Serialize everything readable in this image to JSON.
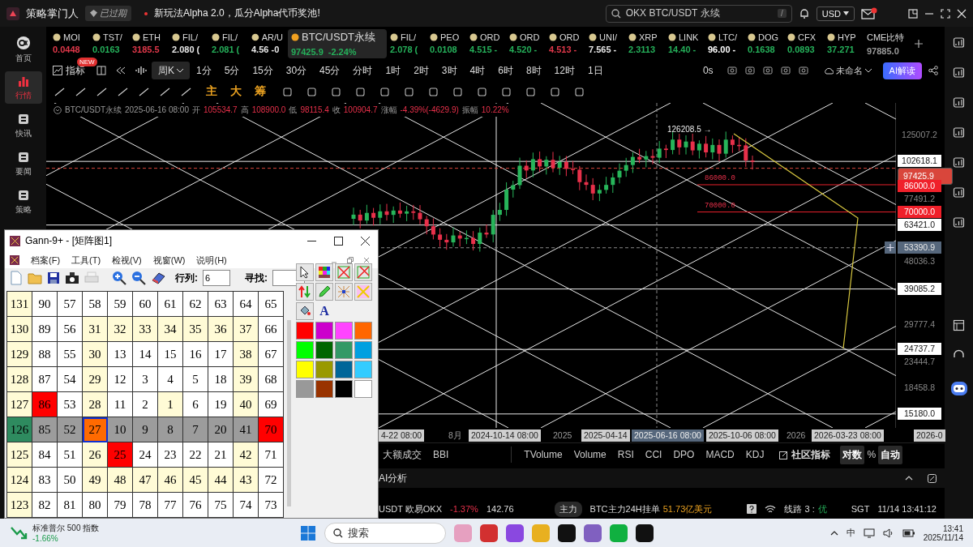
{
  "top_bar": {
    "app_name": "策略掌门人",
    "badge": "已过期",
    "announcement": "新玩法Alpha 2.0，瓜分Alpha代币奖池!",
    "search": "OKX BTC/USDT 永续",
    "search_key": "/",
    "currency": "USD"
  },
  "sidebar": {
    "items": [
      {
        "label": "首页",
        "selected": false
      },
      {
        "label": "行情",
        "selected": true
      },
      {
        "label": "快讯",
        "selected": false
      },
      {
        "label": "要闻",
        "selected": false
      },
      {
        "label": "策略",
        "selected": false
      }
    ]
  },
  "tickers": [
    {
      "name": "MOI",
      "price": "0.0448",
      "color": "#e0384a",
      "selected": false
    },
    {
      "name": "TST/",
      "price": "0.0163",
      "color": "#25b05a",
      "selected": false
    },
    {
      "name": "ETH",
      "price": "3185.5",
      "color": "#e0384a",
      "selected": false
    },
    {
      "name": "FIL/",
      "price": "2.080 (",
      "color": "#e8e8e8",
      "selected": false
    },
    {
      "name": "FIL/",
      "price": "2.081 (",
      "color": "#25b05a",
      "selected": false
    },
    {
      "name": "AR/U",
      "price": "4.56 -0",
      "color": "#e8e8e8",
      "selected": false
    },
    {
      "name": "BTC/USDT永续",
      "price": "97425.9",
      "change": "-2.24%",
      "color": "#25b05a",
      "selected": true
    },
    {
      "name": "FIL/",
      "price": "2.078 (",
      "color": "#25b05a",
      "selected": false
    },
    {
      "name": "PEO",
      "price": "0.0108",
      "color": "#25b05a",
      "selected": false
    },
    {
      "name": "ORD",
      "price": "4.515 -",
      "color": "#25b05a",
      "selected": false
    },
    {
      "name": "ORD",
      "price": "4.520 -",
      "color": "#25b05a",
      "selected": false
    },
    {
      "name": "ORD",
      "price": "4.513 -",
      "color": "#e0384a",
      "selected": false
    },
    {
      "name": "UNI/",
      "price": "7.565 -",
      "color": "#e8e8e8",
      "selected": false
    },
    {
      "name": "XRP",
      "price": "2.3113",
      "color": "#25b05a",
      "selected": false
    },
    {
      "name": "LINK",
      "price": "14.40 -",
      "color": "#25b05a",
      "selected": false
    },
    {
      "name": "LTC/",
      "price": "96.00 -",
      "color": "#ffffff",
      "selected": false
    },
    {
      "name": "DOG",
      "price": "0.1638",
      "color": "#25b05a",
      "selected": false
    },
    {
      "name": "CFX",
      "price": "0.0893",
      "color": "#25b05a",
      "selected": false
    },
    {
      "name": "HYP",
      "price": "37.271",
      "color": "#25b05a",
      "selected": false
    },
    {
      "name": "CME比特",
      "price": "97885.0",
      "color": "#9a9a9a",
      "selected": false
    }
  ],
  "toolbar": {
    "indicator_label": "指标",
    "new_badge": "NEW",
    "period": "周K",
    "timeframes": [
      "1分",
      "5分",
      "15分",
      "30分",
      "45分",
      "分时",
      "1时",
      "2时",
      "3时",
      "4时",
      "6时",
      "8时",
      "12时",
      "1日"
    ],
    "refresh": "0s",
    "layout_name": "未命名",
    "ai_button": "AI解读"
  },
  "drawing_tools": {
    "markers": [
      "主",
      "大",
      "筹"
    ]
  },
  "chart": {
    "info": {
      "symbol": "BTC/USDT永续",
      "date": "2025-06-16 08:00",
      "fields": [
        {
          "label": "开",
          "value": "105534.7"
        },
        {
          "label": "高",
          "value": "108900.0"
        },
        {
          "label": "低",
          "value": "98115.4"
        },
        {
          "label": "收",
          "value": "100904.7"
        },
        {
          "label": "涨幅",
          "value": "-4.39%(-4629.9)"
        },
        {
          "label": "振幅",
          "value": "10.22%"
        }
      ]
    },
    "high_label": "126208.5 →",
    "levels": [
      {
        "text": "86000.0"
      },
      {
        "text": "70000.0"
      }
    ],
    "price_labels": [
      {
        "text": "125007.2",
        "kind": "tick"
      },
      {
        "text": "102618.1",
        "kind": "line"
      },
      {
        "text": "97425.9",
        "kind": "current"
      },
      {
        "text": "86000.0",
        "kind": "alert"
      },
      {
        "text": "77491.2",
        "kind": "tick"
      },
      {
        "text": "70000.0",
        "kind": "alert"
      },
      {
        "text": "63421.0",
        "kind": "line"
      },
      {
        "text": "53390.9",
        "kind": "cursor"
      },
      {
        "text": "48036.3",
        "kind": "tick"
      },
      {
        "text": "39085.2",
        "kind": "line"
      },
      {
        "text": "29777.4",
        "kind": "tick"
      },
      {
        "text": "24737.7",
        "kind": "line"
      },
      {
        "text": "23444.7",
        "kind": "tick"
      },
      {
        "text": "18458.8",
        "kind": "tick"
      },
      {
        "text": "15180.0",
        "kind": "line"
      }
    ],
    "time_labels": [
      {
        "text": "4-22 08:00",
        "kind": "box"
      },
      {
        "text": "8月",
        "kind": "plain"
      },
      {
        "text": "2024-10-14 08:00",
        "kind": "box"
      },
      {
        "text": "2025",
        "kind": "plain"
      },
      {
        "text": "2025-04-14",
        "kind": "box"
      },
      {
        "text": "2025-06-16 08:00",
        "kind": "cursor"
      },
      {
        "text": "2025-10-06 08:00",
        "kind": "box"
      },
      {
        "text": "2026",
        "kind": "plain"
      },
      {
        "text": "2026-03-23 08:00",
        "kind": "box"
      },
      {
        "text": "2026-0",
        "kind": "box"
      }
    ]
  },
  "indicator_tabs": {
    "left": [
      "大额成交",
      "BBI"
    ],
    "right": [
      "TVolume",
      "Volume",
      "RSI",
      "CCI",
      "DPO",
      "MACD",
      "KDJ"
    ],
    "community": "社区指标",
    "scale": [
      {
        "label": "对数",
        "selected": true
      },
      {
        "label": "%",
        "selected": false
      },
      {
        "label": "自动",
        "selected": true
      }
    ]
  },
  "ai_panel": {
    "title": "AI分析"
  },
  "status_bar": {
    "pair": "USDT 欧易OKX",
    "change": "-1.37%",
    "value": "142.76",
    "tag": "主力",
    "order_label": "BTC主力24H挂单",
    "order_value": "51.73亿美元",
    "route_label": "线路 3 :",
    "route_quality": "优",
    "timezone": "SGT",
    "datetime": "11/14 13:41:12"
  },
  "gann_window": {
    "title": "Gann-9+ - [矩阵图1]",
    "menu": [
      "档案(F)",
      "工具(T)",
      "检视(V)",
      "视窗(W)",
      "说明(H)"
    ],
    "rows_label": "行列:",
    "rows_value": "6",
    "find_label": "寻找:",
    "text_tool": "A",
    "grid": [
      [
        {
          "text": "131",
          "color": "#fffbd6",
          "selected": false
        },
        {
          "text": "90",
          "color": "#ffffff",
          "selected": false
        },
        {
          "text": "57",
          "color": "#ffffff",
          "selected": false
        },
        {
          "text": "58",
          "color": "#ffffff",
          "selected": false
        },
        {
          "text": "59",
          "color": "#ffffff",
          "selected": false
        },
        {
          "text": "60",
          "color": "#ffffff",
          "selected": false
        },
        {
          "text": "61",
          "color": "#ffffff",
          "selected": false
        },
        {
          "text": "62",
          "color": "#ffffff",
          "selected": false
        },
        {
          "text": "63",
          "color": "#ffffff",
          "selected": false
        },
        {
          "text": "64",
          "color": "#ffffff",
          "selected": false
        },
        {
          "text": "65",
          "color": "#ffffff",
          "selected": false
        }
      ],
      [
        {
          "text": "130",
          "color": "#fffbd6",
          "selected": false
        },
        {
          "text": "89",
          "color": "#ffffff",
          "selected": false
        },
        {
          "text": "56",
          "color": "#ffffff",
          "selected": false
        },
        {
          "text": "31",
          "color": "#fffbd6",
          "selected": false
        },
        {
          "text": "32",
          "color": "#fffbd6",
          "selected": false
        },
        {
          "text": "33",
          "color": "#fffbd6",
          "selected": false
        },
        {
          "text": "34",
          "color": "#fffbd6",
          "selected": false
        },
        {
          "text": "35",
          "color": "#fffbd6",
          "selected": false
        },
        {
          "text": "36",
          "color": "#fffbd6",
          "selected": false
        },
        {
          "text": "37",
          "color": "#fffbd6",
          "selected": false
        },
        {
          "text": "66",
          "color": "#ffffff",
          "selected": false
        }
      ],
      [
        {
          "text": "129",
          "color": "#fffbd6",
          "selected": false
        },
        {
          "text": "88",
          "color": "#ffffff",
          "selected": false
        },
        {
          "text": "55",
          "color": "#ffffff",
          "selected": false
        },
        {
          "text": "30",
          "color": "#fffbd6",
          "selected": false
        },
        {
          "text": "13",
          "color": "#ffffff",
          "selected": false
        },
        {
          "text": "14",
          "color": "#ffffff",
          "selected": false
        },
        {
          "text": "15",
          "color": "#ffffff",
          "selected": false
        },
        {
          "text": "16",
          "color": "#ffffff",
          "selected": false
        },
        {
          "text": "17",
          "color": "#ffffff",
          "selected": false
        },
        {
          "text": "38",
          "color": "#fffbd6",
          "selected": false
        },
        {
          "text": "67",
          "color": "#ffffff",
          "selected": false
        }
      ],
      [
        {
          "text": "128",
          "color": "#fffbd6",
          "selected": false
        },
        {
          "text": "87",
          "color": "#ffffff",
          "selected": false
        },
        {
          "text": "54",
          "color": "#ffffff",
          "selected": false
        },
        {
          "text": "29",
          "color": "#fffbd6",
          "selected": false
        },
        {
          "text": "12",
          "color": "#ffffff",
          "selected": false
        },
        {
          "text": "3",
          "color": "#ffffff",
          "selected": false
        },
        {
          "text": "4",
          "color": "#ffffff",
          "selected": false
        },
        {
          "text": "5",
          "color": "#ffffff",
          "selected": false
        },
        {
          "text": "18",
          "color": "#ffffff",
          "selected": false
        },
        {
          "text": "39",
          "color": "#fffbd6",
          "selected": false
        },
        {
          "text": "68",
          "color": "#ffffff",
          "selected": false
        }
      ],
      [
        {
          "text": "127",
          "color": "#fffbd6",
          "selected": false
        },
        {
          "text": "86",
          "color": "#ff0000",
          "selected": false
        },
        {
          "text": "53",
          "color": "#ffffff",
          "selected": false
        },
        {
          "text": "28",
          "color": "#fffbd6",
          "selected": false
        },
        {
          "text": "11",
          "color": "#ffffff",
          "selected": false
        },
        {
          "text": "2",
          "color": "#ffffff",
          "selected": false
        },
        {
          "text": "1",
          "color": "#fffbd6",
          "selected": false
        },
        {
          "text": "6",
          "color": "#ffffff",
          "selected": false
        },
        {
          "text": "19",
          "color": "#ffffff",
          "selected": false
        },
        {
          "text": "40",
          "color": "#fffbd6",
          "selected": false
        },
        {
          "text": "69",
          "color": "#ffffff",
          "selected": false
        }
      ],
      [
        {
          "text": "126",
          "color": "#2e8b5f",
          "selected": false
        },
        {
          "text": "85",
          "color": "#9c9c9c",
          "selected": false
        },
        {
          "text": "52",
          "color": "#9c9c9c",
          "selected": false
        },
        {
          "text": "27",
          "color": "#ff6a00",
          "selected": true
        },
        {
          "text": "10",
          "color": "#9c9c9c",
          "selected": false
        },
        {
          "text": "9",
          "color": "#9c9c9c",
          "selected": false
        },
        {
          "text": "8",
          "color": "#9c9c9c",
          "selected": false
        },
        {
          "text": "7",
          "color": "#9c9c9c",
          "selected": false
        },
        {
          "text": "20",
          "color": "#9c9c9c",
          "selected": false
        },
        {
          "text": "41",
          "color": "#9c9c9c",
          "selected": false
        },
        {
          "text": "70",
          "color": "#ff0000",
          "selected": false
        }
      ],
      [
        {
          "text": "125",
          "color": "#fffbd6",
          "selected": false
        },
        {
          "text": "84",
          "color": "#ffffff",
          "selected": false
        },
        {
          "text": "51",
          "color": "#ffffff",
          "selected": false
        },
        {
          "text": "26",
          "color": "#fffbd6",
          "selected": false
        },
        {
          "text": "25",
          "color": "#ff0000",
          "selected": false
        },
        {
          "text": "24",
          "color": "#ffffff",
          "selected": false
        },
        {
          "text": "23",
          "color": "#ffffff",
          "selected": false
        },
        {
          "text": "22",
          "color": "#ffffff",
          "selected": false
        },
        {
          "text": "21",
          "color": "#ffffff",
          "selected": false
        },
        {
          "text": "42",
          "color": "#fffbd6",
          "selected": false
        },
        {
          "text": "71",
          "color": "#ffffff",
          "selected": false
        }
      ],
      [
        {
          "text": "124",
          "color": "#fffbd6",
          "selected": false
        },
        {
          "text": "83",
          "color": "#ffffff",
          "selected": false
        },
        {
          "text": "50",
          "color": "#ffffff",
          "selected": false
        },
        {
          "text": "49",
          "color": "#fffbd6",
          "selected": false
        },
        {
          "text": "48",
          "color": "#fffbd6",
          "selected": false
        },
        {
          "text": "47",
          "color": "#fffbd6",
          "selected": false
        },
        {
          "text": "46",
          "color": "#fffbd6",
          "selected": false
        },
        {
          "text": "45",
          "color": "#fffbd6",
          "selected": false
        },
        {
          "text": "44",
          "color": "#fffbd6",
          "selected": false
        },
        {
          "text": "43",
          "color": "#fffbd6",
          "selected": false
        },
        {
          "text": "72",
          "color": "#ffffff",
          "selected": false
        }
      ],
      [
        {
          "text": "123",
          "color": "#fffbd6",
          "selected": false
        },
        {
          "text": "82",
          "color": "#ffffff",
          "selected": false
        },
        {
          "text": "81",
          "color": "#ffffff",
          "selected": false
        },
        {
          "text": "80",
          "color": "#ffffff",
          "selected": false
        },
        {
          "text": "79",
          "color": "#ffffff",
          "selected": false
        },
        {
          "text": "78",
          "color": "#ffffff",
          "selected": false
        },
        {
          "text": "77",
          "color": "#ffffff",
          "selected": false
        },
        {
          "text": "76",
          "color": "#ffffff",
          "selected": false
        },
        {
          "text": "75",
          "color": "#ffffff",
          "selected": false
        },
        {
          "text": "74",
          "color": "#ffffff",
          "selected": false
        },
        {
          "text": "73",
          "color": "#ffffff",
          "selected": false
        }
      ]
    ],
    "palette": [
      {
        "color": "#ff0000"
      },
      {
        "color": "#cc00cc"
      },
      {
        "color": "#ff44ff"
      },
      {
        "color": "#ff6600"
      },
      {
        "color": "#00ff00"
      },
      {
        "color": "#006600"
      },
      {
        "color": "#339966"
      },
      {
        "color": "#00a0e0"
      },
      {
        "color": "#ffff00"
      },
      {
        "color": "#999900"
      },
      {
        "color": "#006699"
      },
      {
        "color": "#33ccff"
      },
      {
        "color": "#999999"
      },
      {
        "color": "#993300"
      },
      {
        "color": "#000000"
      },
      {
        "color": "#ffffff"
      }
    ]
  },
  "taskbar": {
    "widget_title": "标准普尔 500 指数",
    "widget_change": "-1.66%",
    "search": "搜索",
    "ime": "中",
    "time": "13:41",
    "date": "2025/11/14"
  }
}
